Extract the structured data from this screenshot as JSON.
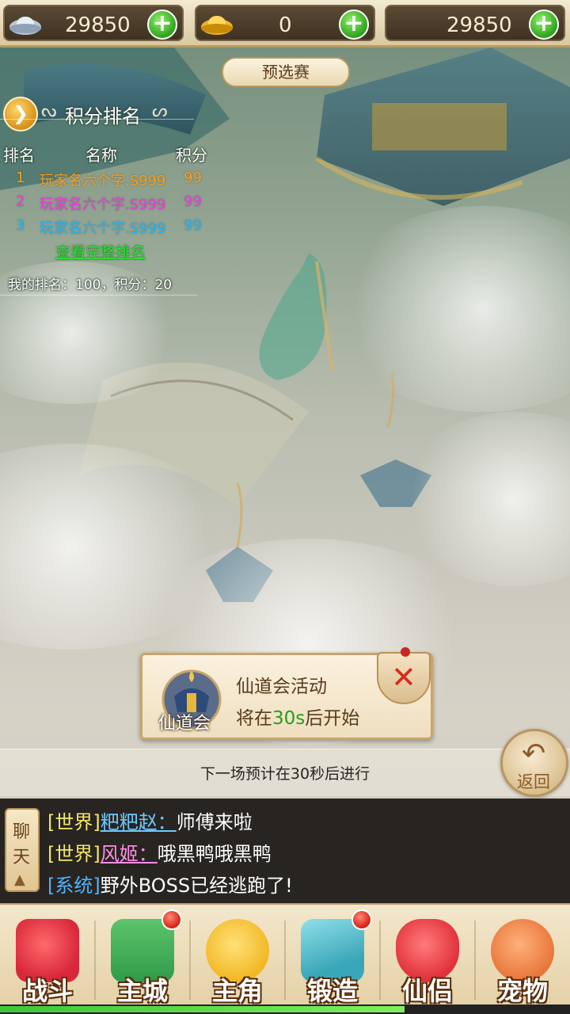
{
  "currency": [
    {
      "icon": "silver-ingot-icon",
      "value": "29850"
    },
    {
      "icon": "gold-ingot-icon",
      "value": "0"
    },
    {
      "icon": "coin-icon",
      "value": "29850"
    }
  ],
  "stage": {
    "label": "预选赛"
  },
  "ranking": {
    "title": "积分排名",
    "headers": {
      "rank": "排名",
      "name": "名称",
      "score": "积分"
    },
    "rows": [
      {
        "rank": "1",
        "name": "玩家名六个字.S999",
        "score": "99",
        "color": "#f7a020"
      },
      {
        "rank": "2",
        "name": "玩家名六个字.S999",
        "score": "99",
        "color": "#f03cde"
      },
      {
        "rank": "3",
        "name": "玩家名六个字.S999",
        "score": "99",
        "color": "#28b6f0"
      }
    ],
    "view_all": "查看完整排名",
    "my_rank": "我的排名：100，积分：20"
  },
  "popup": {
    "icon_label": "仙道会",
    "title": "仙道会活动",
    "msg_prefix": "将在",
    "msg_highlight": "30s",
    "msg_suffix": "后开始"
  },
  "next_match": "下一场预计在30秒后进行",
  "back": {
    "label": "返回"
  },
  "chat": {
    "tab_chars": [
      "聊",
      "天"
    ],
    "lines": [
      {
        "channel": "[世界]",
        "sender": "粑粑赵：",
        "text": "师傅来啦"
      },
      {
        "channel": "[世界]",
        "sender": "风姬：",
        "text": "哦黑鸭哦黑鸭"
      },
      {
        "channel": "[系统]",
        "sender": "",
        "text": "野外BOSS已经逃跑了!"
      }
    ]
  },
  "nav": [
    {
      "label": "战斗",
      "icon": "battle-icon",
      "badge": false,
      "color": "#d8263a"
    },
    {
      "label": "主城",
      "icon": "main-city-icon",
      "badge": true,
      "color": "#2f9a4a"
    },
    {
      "label": "主角",
      "icon": "hero-icon",
      "badge": false,
      "color": "#f2b823"
    },
    {
      "label": "锻造",
      "icon": "forge-hammer-icon",
      "badge": true,
      "color": "#3aa7b8"
    },
    {
      "label": "仙侣",
      "icon": "partner-heart-icon",
      "badge": false,
      "color": "#e0303a"
    },
    {
      "label": "宠物",
      "icon": "pet-monkey-icon",
      "badge": false,
      "color": "#e8763a"
    }
  ],
  "progress": 0.71,
  "colors": {
    "green_plus": "#2fa21b",
    "link_green": "#2fe33a",
    "highlight_green": "#2a9b1c"
  }
}
